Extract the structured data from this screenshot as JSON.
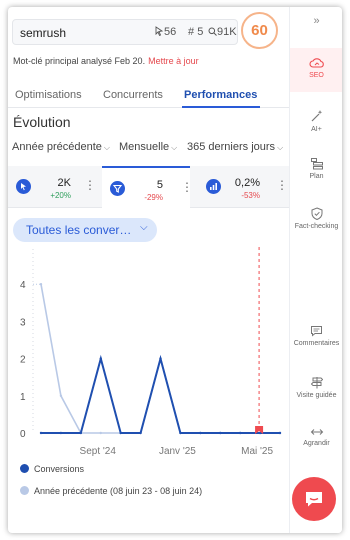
{
  "header": {
    "keyword": "semrush",
    "metric_a": "56",
    "metric_b": "5",
    "metric_c": "91K",
    "score": "60"
  },
  "analyzed": {
    "text": "Mot-clé principal analysé Feb 20.",
    "link": "Mettre à jour"
  },
  "tabs": [
    {
      "label": "Optimisations"
    },
    {
      "label": "Concurrents"
    },
    {
      "label": "Performances"
    }
  ],
  "section_title": "Évolution",
  "filters": {
    "compare": "Année précédente",
    "granularity": "Mensuelle",
    "period": "365 derniers jours"
  },
  "metrics": [
    {
      "value": "2K",
      "delta": "+20%",
      "delta_color": "#2e9e5b",
      "icon": "cursor-click-icon"
    },
    {
      "value": "5",
      "delta": "-29%",
      "delta_color": "#e5484d",
      "icon": "funnel-icon"
    },
    {
      "value": "0,2%",
      "delta": "-53%",
      "delta_color": "#e5484d",
      "icon": "bar-chart-icon"
    }
  ],
  "metric_selector": "Toutes les conver…",
  "chart_data": {
    "type": "line",
    "x": [
      "2024-06",
      "2024-07",
      "2024-08",
      "2024-09",
      "2024-10",
      "2024-11",
      "2024-12",
      "2025-01",
      "2025-02",
      "2025-03",
      "2025-04",
      "2025-05",
      "2025-06"
    ],
    "x_tick_labels": [
      "Sept '24",
      "Janv '25",
      "Mai '25"
    ],
    "y_ticks": [
      0,
      1,
      2,
      3,
      4
    ],
    "ylim": [
      0,
      5
    ],
    "series": [
      {
        "name": "Conversions",
        "color": "#1f4fb0",
        "values": [
          0,
          0,
          0,
          2,
          0,
          0,
          2,
          0,
          0,
          0,
          0,
          0,
          0
        ]
      },
      {
        "name": "Année précédente (08 juin 23 - 08 juin 24)",
        "color": "#b9c9e6",
        "values": [
          4,
          1,
          0,
          0,
          0,
          0,
          2,
          0,
          0,
          0,
          0,
          0,
          0
        ]
      }
    ],
    "marker_date": "2025-05"
  },
  "sidebar": {
    "items": [
      {
        "label": "SEO",
        "icon": "seo-cloud-icon"
      },
      {
        "label": "AI+",
        "icon": "magic-wand-icon"
      },
      {
        "label": "Plan",
        "icon": "plan-list-icon"
      },
      {
        "label": "Fact-checking",
        "icon": "shield-check-icon"
      },
      {
        "label": "Commentaires",
        "icon": "comment-icon"
      },
      {
        "label": "Visite guidée",
        "icon": "guided-tour-icon"
      },
      {
        "label": "Agrandir",
        "icon": "expand-arrows-icon"
      }
    ]
  },
  "colors": {
    "accent": "#2a5bd7",
    "brand_red": "#ef4a4f",
    "score": "#f08a4b"
  }
}
